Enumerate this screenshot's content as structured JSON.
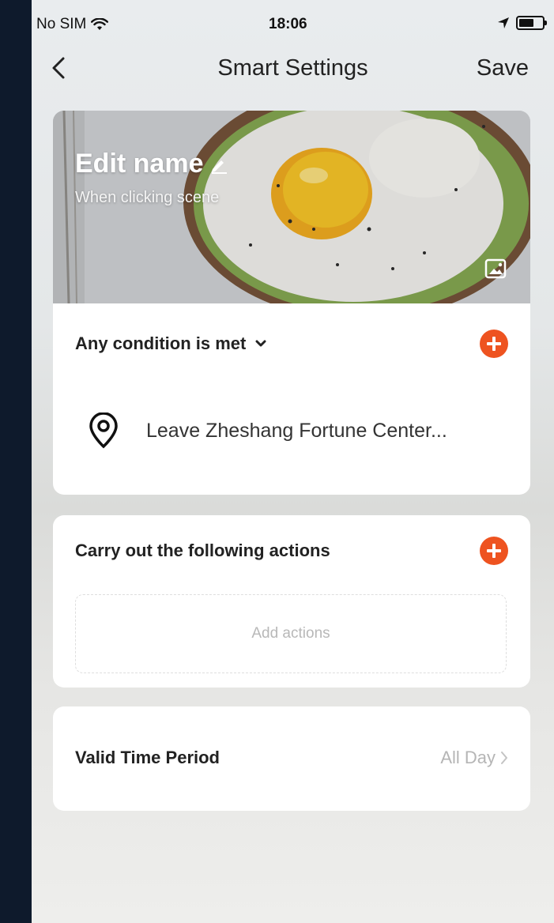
{
  "status_bar": {
    "carrier": "No SIM",
    "time": "18:06"
  },
  "nav": {
    "title": "Smart Settings",
    "save_label": "Save"
  },
  "hero": {
    "title": "Edit name",
    "subtitle": "When clicking scene"
  },
  "condition_card": {
    "header": "Any condition is met",
    "condition_text": "Leave Zheshang Fortune Center..."
  },
  "actions_card": {
    "header": "Carry out the following actions",
    "placeholder": "Add actions"
  },
  "time_card": {
    "label": "Valid Time Period",
    "value": "All Day"
  },
  "colors": {
    "accent": "#ee5320",
    "page_bg": "#0e1a2c",
    "card_bg": "#ffffff"
  },
  "icons": [
    "back-chevron-icon",
    "wifi-icon",
    "location-arrow-icon",
    "battery-icon",
    "edit-pencil-icon",
    "change-image-icon",
    "chevron-down-icon",
    "add-icon",
    "location-pin-icon",
    "chevron-right-icon"
  ]
}
